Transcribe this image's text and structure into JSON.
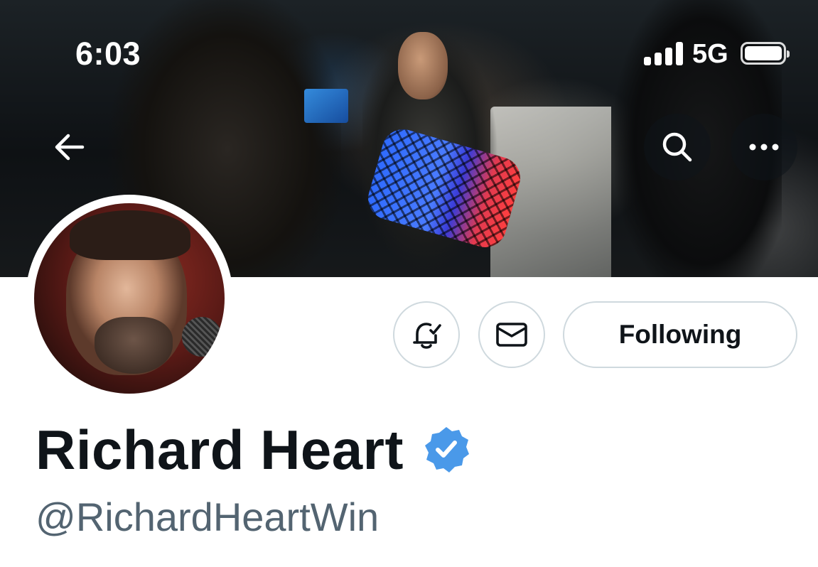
{
  "status_bar": {
    "time": "6:03",
    "network": "5G",
    "signal_bars": 4,
    "battery_level": 1.0
  },
  "banner": {
    "back_icon": "arrow-left-icon",
    "search_icon": "search-icon",
    "more_icon": "more-horizontal-icon"
  },
  "actions": {
    "notify_icon": "bell-check-icon",
    "message_icon": "envelope-icon",
    "following_label": "Following"
  },
  "profile": {
    "display_name": "Richard Heart",
    "handle": "@RichardHeartWin",
    "verified": true,
    "verified_color": "#4a99e9"
  },
  "colors": {
    "text_primary": "#0f1419",
    "text_secondary": "#536471",
    "button_border": "#cfd9de"
  }
}
